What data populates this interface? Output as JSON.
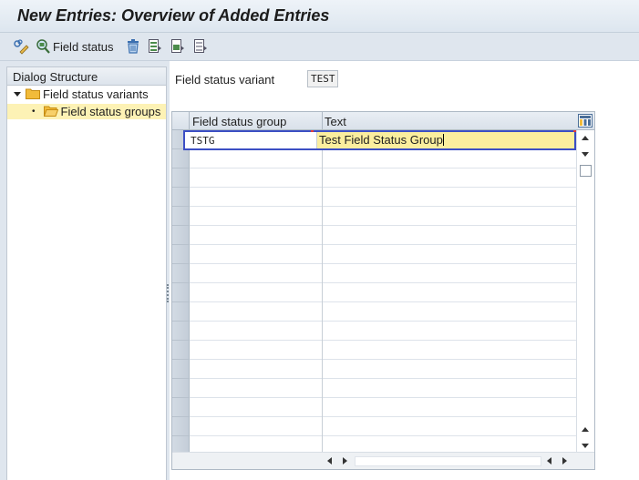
{
  "window": {
    "title": "New Entries: Overview of Added Entries"
  },
  "toolbar": {
    "items": [
      {
        "icon": "display-change-icon",
        "label": ""
      },
      {
        "icon": "field-status-icon",
        "label": "Field status"
      },
      {
        "icon": "delete-icon",
        "label": ""
      },
      {
        "icon": "select-all-icon",
        "label": ""
      },
      {
        "icon": "select-block-icon",
        "label": ""
      },
      {
        "icon": "deselect-all-icon",
        "label": ""
      }
    ]
  },
  "dialog_structure": {
    "header": "Dialog Structure",
    "items": [
      {
        "label": "Field status variants",
        "expanded": true,
        "selected": false
      },
      {
        "label": "Field status groups",
        "expanded": false,
        "selected": true
      }
    ]
  },
  "main": {
    "field_status_variant": {
      "label": "Field status variant",
      "value": "TEST"
    },
    "table": {
      "columns": [
        "Field status group",
        "Text"
      ],
      "rows": [
        {
          "field_status_group": "TSTG",
          "text": "Test Field Status Group"
        }
      ]
    }
  },
  "colors": {
    "selection_highlight": "#fdf2b5",
    "edit_cell": "#fbee9e",
    "focus_border": "#3c4fc4",
    "folder": "#f2bb3a"
  }
}
